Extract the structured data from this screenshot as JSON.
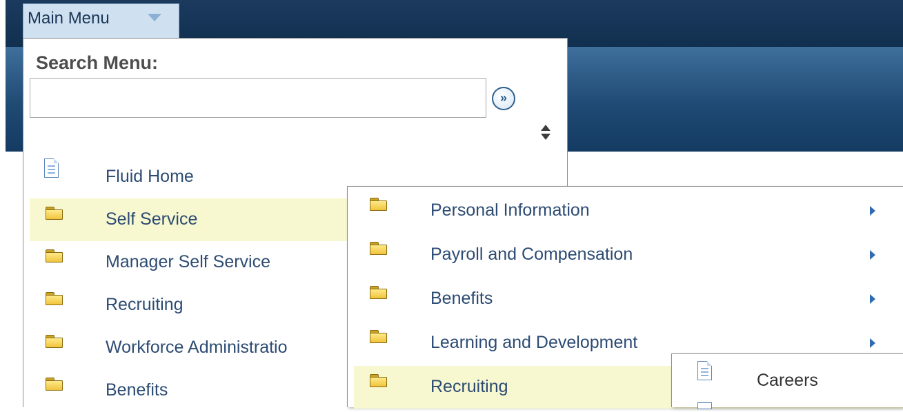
{
  "header": {
    "main_menu_label": "Main Menu"
  },
  "search": {
    "label": "Search Menu:",
    "value": "",
    "placeholder": ""
  },
  "menu": {
    "items": [
      {
        "label": "Fluid Home",
        "icon": "page-icon"
      },
      {
        "label": "Self Service",
        "icon": "folder-icon",
        "highlighted": true
      },
      {
        "label": "Manager Self Service",
        "icon": "folder-icon"
      },
      {
        "label": "Recruiting",
        "icon": "folder-icon"
      },
      {
        "label": "Workforce Administratio",
        "icon": "folder-icon"
      },
      {
        "label": "Benefits",
        "icon": "folder-icon"
      }
    ]
  },
  "submenu": {
    "items": [
      {
        "label": "Personal Information",
        "icon": "folder-icon",
        "has_children": true
      },
      {
        "label": "Payroll and Compensation",
        "icon": "folder-icon",
        "has_children": true
      },
      {
        "label": "Benefits",
        "icon": "folder-icon",
        "has_children": true
      },
      {
        "label": "Learning and Development",
        "icon": "folder-icon",
        "has_children": true
      },
      {
        "label": "Recruiting",
        "icon": "folder-icon",
        "highlighted": true
      }
    ]
  },
  "submenu2": {
    "items": [
      {
        "label": "Careers",
        "icon": "page-icon"
      }
    ]
  },
  "colors": {
    "header_bg": "#11304f",
    "banner_bg": "#2a5886",
    "highlight": "#f8f8d0",
    "link_text": "#2c4b73",
    "folder": "#f0c43c"
  }
}
